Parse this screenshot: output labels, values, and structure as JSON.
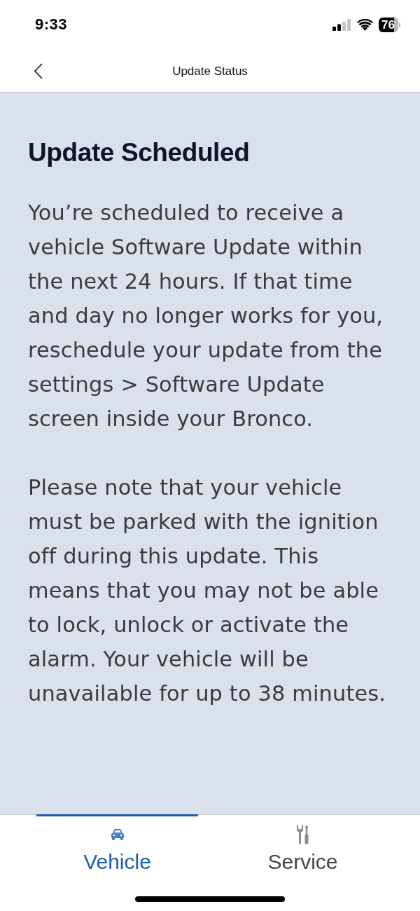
{
  "status_bar": {
    "time": "9:33",
    "battery": "76"
  },
  "header": {
    "title": "Update Status"
  },
  "content": {
    "title": "Update Scheduled",
    "paragraphs": [
      "You’re scheduled to receive a vehicle Software Update within the next 24 hours. If that time and day no longer works for you, reschedule your update from the settings > Software Update screen inside your Bronco.",
      "Please note that your vehicle must be parked with the ignition off during this update. This means that you may not be able to lock, unlock or activate the alarm. Your vehicle will be unavailable for up to 38 minutes."
    ]
  },
  "tabs": [
    {
      "kind": "vehicle",
      "label": "Vehicle",
      "selected": true
    },
    {
      "kind": "service",
      "label": "Service",
      "selected": false
    }
  ]
}
